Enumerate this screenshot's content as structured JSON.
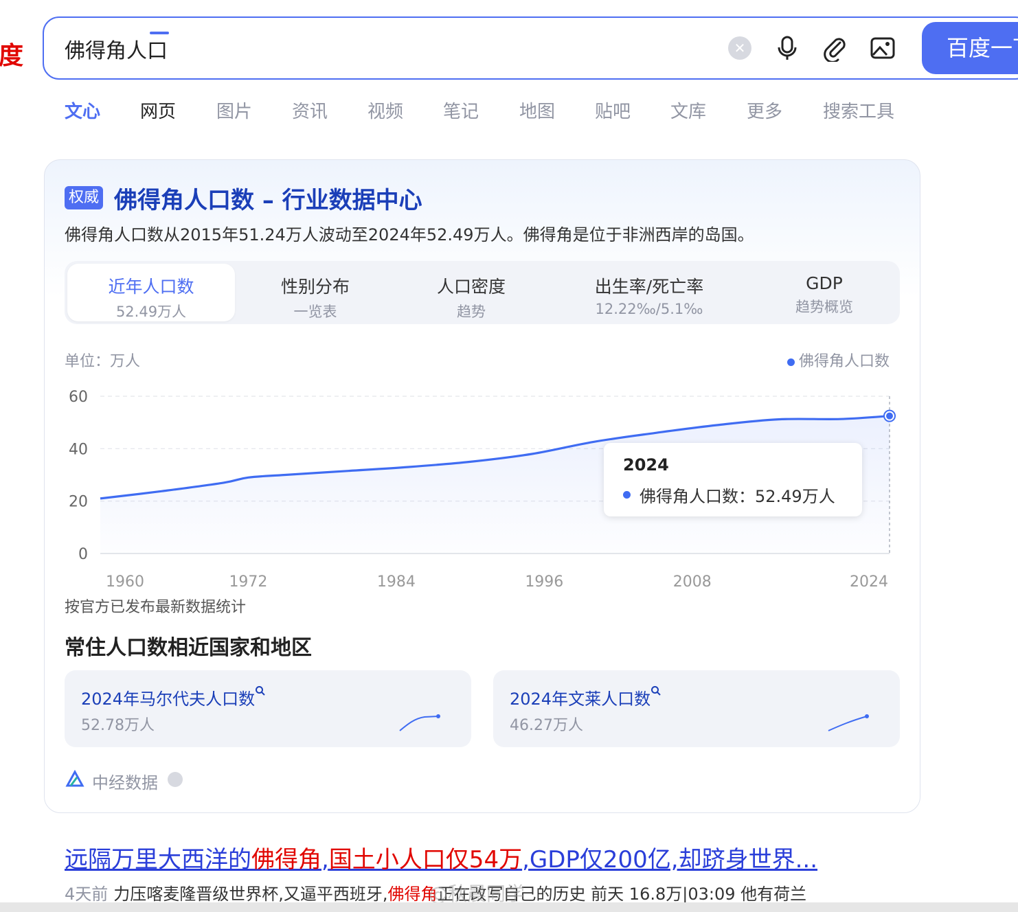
{
  "header": {
    "logo_fragment": "度",
    "search_value": "佛得角人口",
    "submit_label": "百度一下",
    "icons": [
      "clear-icon",
      "microphone-icon",
      "attachment-icon",
      "image-search-icon"
    ]
  },
  "tabs": [
    {
      "label": "文心",
      "state": "brand"
    },
    {
      "label": "网页",
      "state": "active"
    },
    {
      "label": "图片"
    },
    {
      "label": "资讯"
    },
    {
      "label": "视频"
    },
    {
      "label": "笔记"
    },
    {
      "label": "地图"
    },
    {
      "label": "贴吧"
    },
    {
      "label": "文库"
    },
    {
      "label": "更多"
    },
    {
      "label": "搜索工具"
    }
  ],
  "card": {
    "badge": "权威",
    "title": "佛得角人口数 – 行业数据中心",
    "summary": "佛得角人口数从2015年51.24万人波动至2024年52.49万人。佛得角是位于非洲西岸的岛国。",
    "subtabs": [
      {
        "label": "近年人口数",
        "sub": "52.49万人",
        "active": true
      },
      {
        "label": "性别分布",
        "sub": "一览表"
      },
      {
        "label": "人口密度",
        "sub": "趋势"
      },
      {
        "label": "出生率/死亡率",
        "sub": "12.22‰/5.1‰"
      },
      {
        "label": "GDP",
        "sub": "趋势概览"
      }
    ],
    "unit": "单位：万人",
    "legend": "佛得角人口数",
    "tooltip": {
      "year": "2024",
      "text": "佛得角人口数：52.49万人"
    },
    "note": "按官方已发布最新数据统计",
    "related_title": "常住人口数相近国家和地区",
    "related": [
      {
        "title": "2024年马尔代夫人口数",
        "value": "52.78万人"
      },
      {
        "title": "2024年文莱人口数",
        "value": "46.27万人"
      }
    ],
    "source": "中经数据"
  },
  "chart_data": {
    "type": "line",
    "title": "",
    "xlabel": "",
    "ylabel": "单位：万人",
    "x_ticks": [
      "1960",
      "1972",
      "1984",
      "1996",
      "2008",
      "2024"
    ],
    "y_ticks": [
      "0",
      "20",
      "40",
      "60"
    ],
    "xlim": [
      1960,
      2024
    ],
    "ylim": [
      0,
      60
    ],
    "grid": true,
    "legend_position": "top-right",
    "series": [
      {
        "name": "佛得角人口数",
        "color": "#3f6cf2",
        "x": [
          1960,
          1965,
          1970,
          1972,
          1975,
          1980,
          1985,
          1990,
          1995,
          2000,
          2005,
          2010,
          2015,
          2020,
          2024
        ],
        "y": [
          21.0,
          23.8,
          27.0,
          29.0,
          30.0,
          31.5,
          33.0,
          35.0,
          38.0,
          42.6,
          46.0,
          49.0,
          51.2,
          51.3,
          52.49
        ]
      }
    ],
    "highlight": {
      "x": 2024,
      "y": 52.49
    }
  },
  "result": {
    "title_parts": [
      {
        "text": "远隔万里大西洋的",
        "hl": false
      },
      {
        "text": "佛得角",
        "hl": true
      },
      {
        "text": ",",
        "hl": false
      },
      {
        "text": "国土小人口仅54万",
        "hl": true
      },
      {
        "text": ",GDP仅200亿,却跻身世界...",
        "hl": false
      }
    ],
    "time": "4天前",
    "snippet_a": "力压喀麦隆晋级世界杯,又逼平西班牙,",
    "snippet_hl": "佛得角",
    "snippet_b": "正在改写自己的历史 前天 16.8万|03:09 他有荷兰",
    "watermark": "@秋晨同学"
  },
  "colors": {
    "accent": "#4e6ef2",
    "link": "#2a3ed9",
    "highlight": "#e10601",
    "line": "#3f6cf2"
  }
}
